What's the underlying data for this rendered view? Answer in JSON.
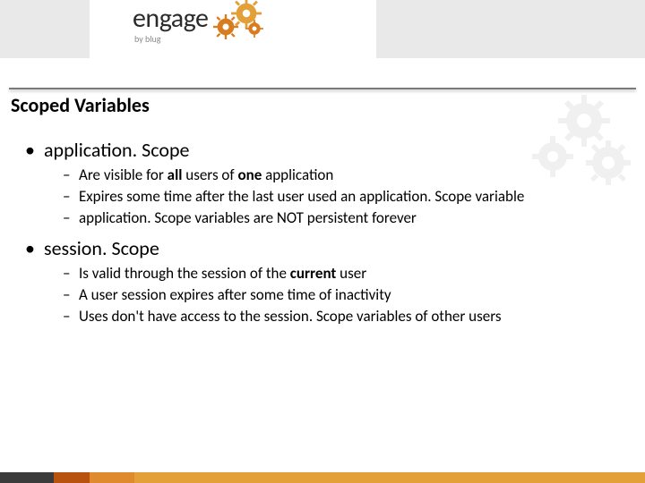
{
  "logo": {
    "word": "engage",
    "subtitle": "by blug"
  },
  "slide": {
    "title": "Scoped Variables",
    "sections": [
      {
        "heading": "application. Scope",
        "items": [
          {
            "pre": "Are visible for ",
            "b1": "all",
            "mid": " users of ",
            "b2": "one",
            "post": " application"
          },
          {
            "pre": "Expires some time after the last user used an application. Scope variable"
          },
          {
            "pre": "application. Scope variables are NOT persistent forever"
          }
        ]
      },
      {
        "heading": "session. Scope",
        "items": [
          {
            "pre": "Is valid through the session of the ",
            "b1": "current",
            "post": " user"
          },
          {
            "pre": "A user session expires after some time of inactivity"
          },
          {
            "pre": "Uses don't have access to the session. Scope variables of other users"
          }
        ]
      }
    ]
  }
}
